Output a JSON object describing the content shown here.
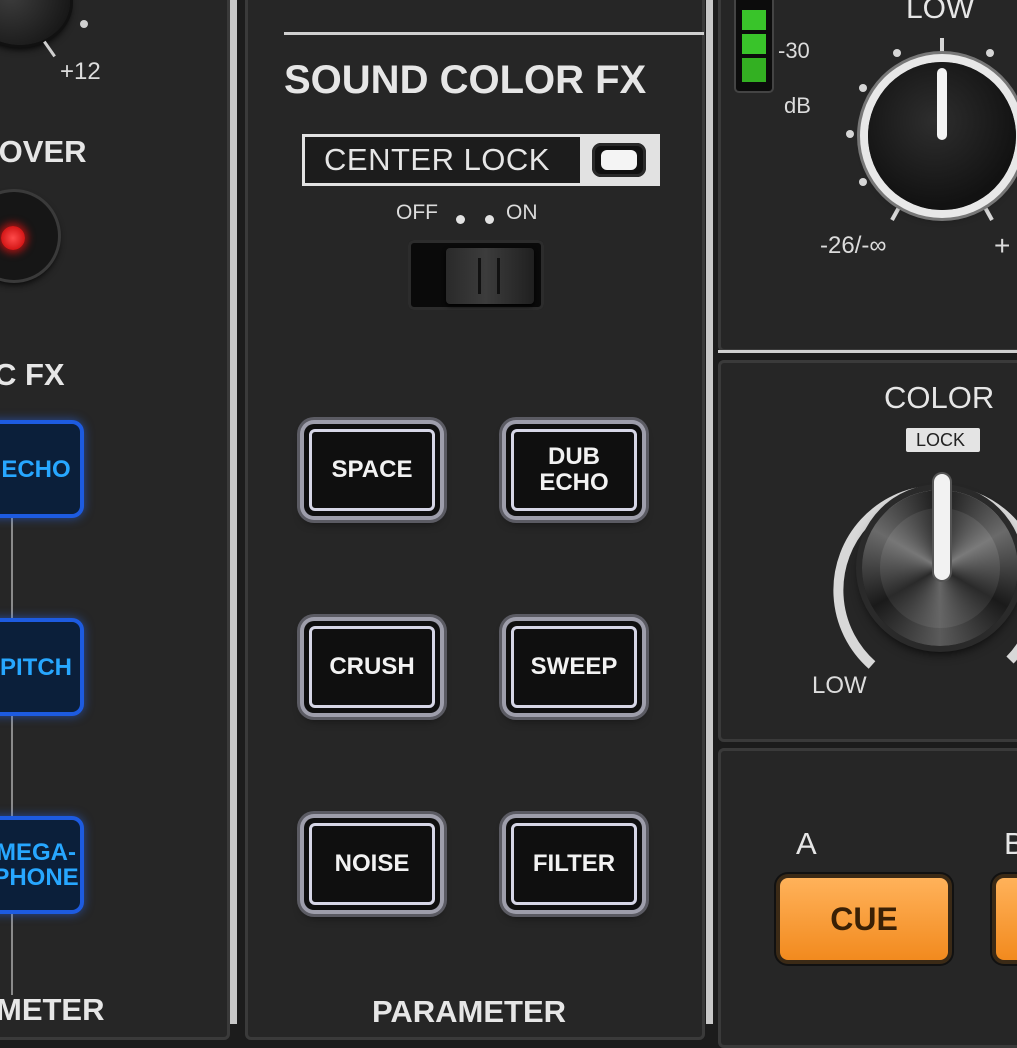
{
  "left_column": {
    "trim_max_label": "+12",
    "crossover_label": "XOVER",
    "beat_fx_label": "C FX",
    "fx_buttons": [
      "ECHO",
      "PITCH",
      "MEGA-\nPHONE"
    ],
    "parameter_label": "METER"
  },
  "sound_color_fx": {
    "title": "SOUND COLOR FX",
    "center_lock_label": "CENTER  LOCK",
    "switch_off_label": "OFF",
    "switch_on_label": "ON",
    "buttons": [
      "SPACE",
      "DUB\nECHO",
      "CRUSH",
      "SWEEP",
      "NOISE",
      "FILTER"
    ],
    "parameter_label": "PARAMETER"
  },
  "eq": {
    "meter_label": "-30",
    "meter_unit": "dB",
    "low_label": "LOW",
    "min_label": "-26/-∞",
    "max_label": "+"
  },
  "color": {
    "title": "COLOR",
    "lock_label": "LOCK",
    "low_label": "LOW"
  },
  "cue_section": {
    "a_label": "A",
    "b_label": "B",
    "cue_label": "CUE"
  },
  "colors": {
    "accent_blue": "#1d5be0",
    "cue_orange": "#f28a1e",
    "led_red": "#e01010",
    "meter_green": "#39c42a"
  }
}
